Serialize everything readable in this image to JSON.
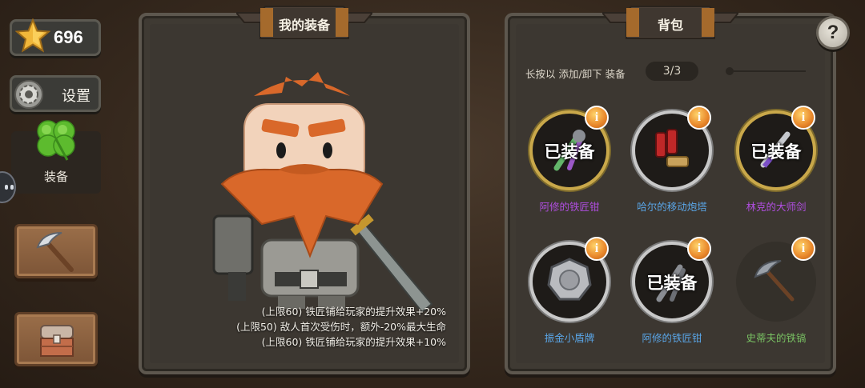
{
  "currency": {
    "stars": "696",
    "icon": "star-icon"
  },
  "sidebar": {
    "settings_label": "设置",
    "equip_tab_label": "装备"
  },
  "equip_panel": {
    "title": "我的装备",
    "buffs": [
      "(上限60) 铁匠铺给玩家的提升效果+20%",
      "(上限50) 敌人首次受伤时，额外-20%最大生命",
      "(上限60) 铁匠铺给玩家的提升效果+10%"
    ]
  },
  "backpack": {
    "title": "背包",
    "hint": "长按以 添加/卸下 装备",
    "capacity": "3/3",
    "equipped_label": "已装备",
    "items": [
      {
        "name": "阿修的铁匠钳",
        "equipped": true,
        "rarity": "gold",
        "name_color": "#b04ee0"
      },
      {
        "name": "哈尔的移动炮塔",
        "equipped": false,
        "rarity": "silver",
        "name_color": "#5aa6e8"
      },
      {
        "name": "林克的大师剑",
        "equipped": true,
        "rarity": "gold",
        "name_color": "#b04ee0"
      },
      {
        "name": "振金小盾牌",
        "equipped": false,
        "rarity": "silver",
        "name_color": "#5aa6e8"
      },
      {
        "name": "阿修的铁匠钳",
        "equipped": true,
        "rarity": "silver",
        "name_color": "#5aa6e8"
      },
      {
        "name": "史蒂夫的铁镐",
        "equipped": false,
        "rarity": "plain",
        "name_color": "#79c263"
      }
    ]
  },
  "help": "?"
}
